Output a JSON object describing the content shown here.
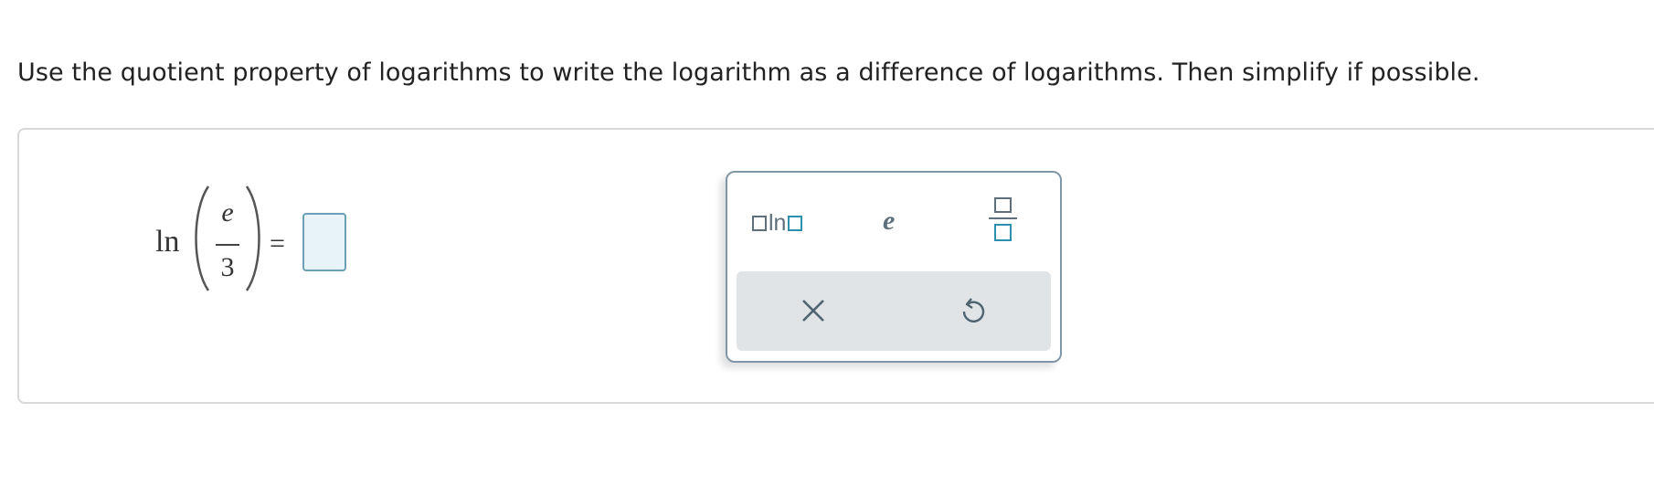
{
  "question": {
    "instructions": "Use the quotient property of logarithms to write the logarithm as a difference of logarithms. Then simplify if possible."
  },
  "expression": {
    "function": "ln",
    "numerator": "e",
    "denominator": "3",
    "equals": "="
  },
  "answer": {
    "value": ""
  },
  "palette": {
    "ln_label": "ln",
    "e_label": "e",
    "buttons": [
      "log-template",
      "e-constant",
      "fraction-template",
      "clear",
      "undo"
    ]
  },
  "colors": {
    "panel_border": "#d9d9d9",
    "input_fill": "#e7f3f7",
    "input_border": "#6c9fb5",
    "palette_border": "#7f97a6",
    "action_bar": "#e0e4e7",
    "icon": "#5d707c",
    "teal_slot": "#2f8fae"
  }
}
